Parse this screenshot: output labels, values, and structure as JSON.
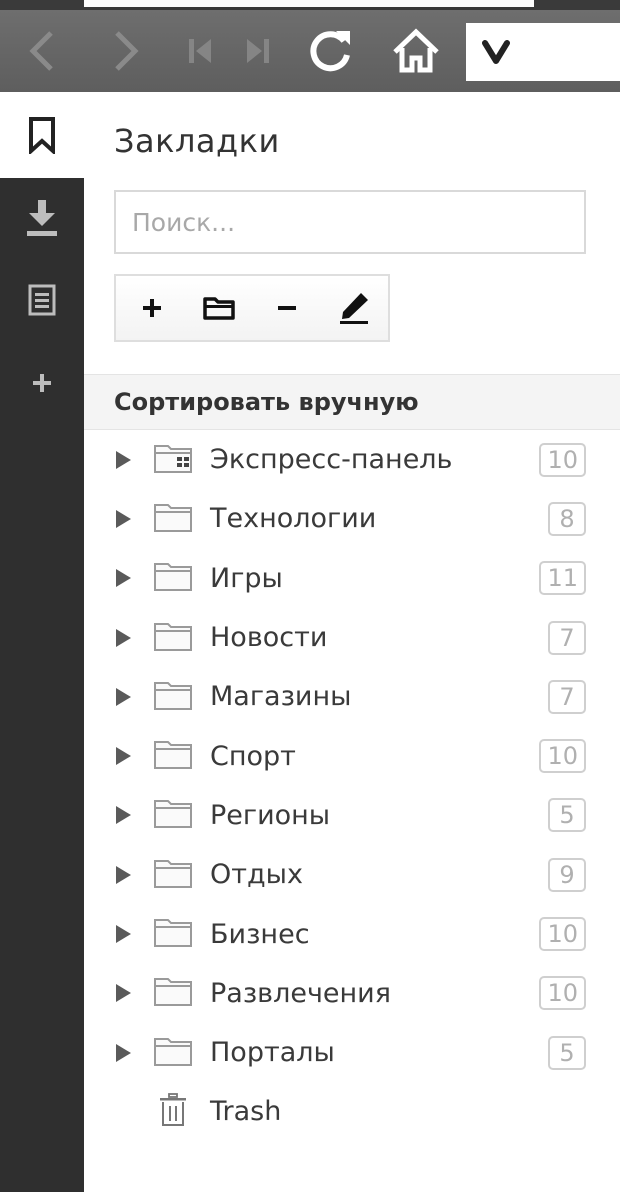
{
  "toolbar": {
    "back_icon": "chevron-left-icon",
    "forward_icon": "chevron-right-icon",
    "rewind_icon": "skip-back-icon",
    "fastforward_icon": "skip-forward-icon",
    "reload_icon": "reload-icon",
    "home_icon": "home-icon",
    "address_logo": "vivaldi-logo"
  },
  "sidebar": {
    "items": [
      {
        "icon": "bookmark-icon",
        "active": true
      },
      {
        "icon": "download-icon"
      },
      {
        "icon": "notes-icon"
      },
      {
        "icon": "plus-icon"
      }
    ]
  },
  "panel": {
    "title": "Закладки",
    "search_placeholder": "Поиск...",
    "actions": [
      "add-icon",
      "folder-icon",
      "minus-icon",
      "edit-icon"
    ],
    "sort_label": "Сортировать вручную",
    "folders": [
      {
        "label": "Экспресс-панель",
        "count": "10",
        "icon": "speed-dial-folder-icon"
      },
      {
        "label": "Технологии",
        "count": "8",
        "icon": "folder-icon"
      },
      {
        "label": "Игры",
        "count": "11",
        "icon": "folder-icon"
      },
      {
        "label": "Новости",
        "count": "7",
        "icon": "folder-icon"
      },
      {
        "label": "Магазины",
        "count": "7",
        "icon": "folder-icon"
      },
      {
        "label": "Спорт",
        "count": "10",
        "icon": "folder-icon"
      },
      {
        "label": "Регионы",
        "count": "5",
        "icon": "folder-icon"
      },
      {
        "label": "Отдых",
        "count": "9",
        "icon": "folder-icon"
      },
      {
        "label": "Бизнес",
        "count": "10",
        "icon": "folder-icon"
      },
      {
        "label": "Развлечения",
        "count": "10",
        "icon": "folder-icon"
      },
      {
        "label": "Порталы",
        "count": "5",
        "icon": "folder-icon"
      }
    ],
    "trash_label": "Trash"
  }
}
